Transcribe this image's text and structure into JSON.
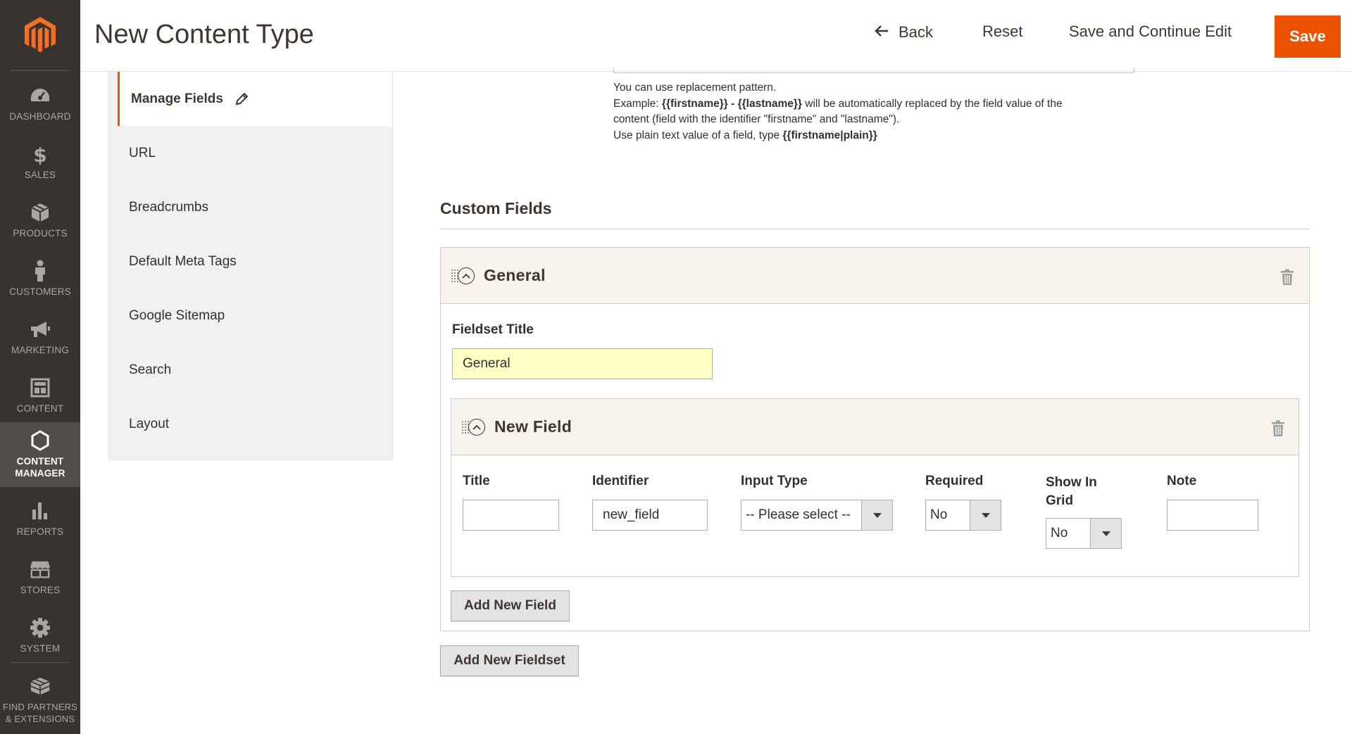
{
  "nav": {
    "items": [
      {
        "label": "DASHBOARD",
        "icon": "dashboard-icon"
      },
      {
        "label": "SALES",
        "icon": "dollar-icon"
      },
      {
        "label": "PRODUCTS",
        "icon": "box-icon"
      },
      {
        "label": "CUSTOMERS",
        "icon": "person-icon"
      },
      {
        "label": "MARKETING",
        "icon": "megaphone-icon"
      },
      {
        "label": "CONTENT",
        "icon": "layout-icon"
      },
      {
        "label_line1": "CONTENT",
        "label_line2": "MANAGER",
        "icon": "hexagon-icon"
      },
      {
        "label": "REPORTS",
        "icon": "bar-chart-icon"
      },
      {
        "label": "STORES",
        "icon": "store-icon"
      },
      {
        "label": "SYSTEM",
        "icon": "gear-icon"
      },
      {
        "label_line1": "FIND PARTNERS",
        "label_line2": "& EXTENSIONS",
        "icon": "blocks-icon"
      }
    ]
  },
  "header": {
    "title": "New Content Type",
    "back_label": "Back",
    "reset_label": "Reset",
    "save_continue_label": "Save and Continue Edit",
    "save_label": "Save"
  },
  "tabs": [
    {
      "label": "Manage Fields",
      "active": true
    },
    {
      "label": "URL"
    },
    {
      "label": "Breadcrumbs"
    },
    {
      "label": "Default Meta Tags"
    },
    {
      "label": "Google Sitemap"
    },
    {
      "label": "Search"
    },
    {
      "label": "Layout"
    }
  ],
  "note": {
    "line1": "You can use replacement pattern.",
    "line2_prefix": "Example: ",
    "line2_bold": "{{firstname}} - {{lastname}}",
    "line2_suffix": " will be automatically replaced by the field value of the",
    "line3": "content (field with the identifier \"firstname\" and \"lastname\").",
    "line4_prefix": "Use plain text value of a field, type ",
    "line4_bold": "{{firstname|plain}}"
  },
  "custom_fields": {
    "section_title": "Custom Fields",
    "fieldset": {
      "title": "General",
      "fieldset_title_label": "Fieldset Title",
      "fieldset_title_value": "General",
      "new_field": {
        "title": "New Field",
        "columns": {
          "title_label": "Title",
          "title_value": "",
          "identifier_label": "Identifier",
          "identifier_value": "new_field",
          "input_type_label": "Input Type",
          "input_type_value": "-- Please select --",
          "required_label": "Required",
          "required_value": "No",
          "show_in_grid_label_line1": "Show In",
          "show_in_grid_label_line2": "Grid",
          "show_in_grid_value": "No",
          "note_label": "Note",
          "note_value": ""
        }
      },
      "add_field_label": "Add New Field"
    },
    "add_fieldset_label": "Add New Fieldset"
  },
  "colors": {
    "accent": "#eb5202",
    "nav_bg": "#373330",
    "nav_active": "#524d49",
    "fieldset_head_bg": "#f8f4ed",
    "highlight_input": "#ffffc6"
  }
}
